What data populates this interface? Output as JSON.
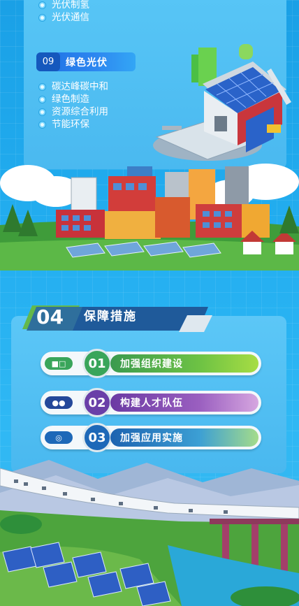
{
  "top_list": [
    "光伏制氢",
    "光伏通信"
  ],
  "section09": {
    "num": "09",
    "title": "绿色光伏",
    "items": [
      "碳达峰碳中和",
      "绿色制造",
      "资源综合利用",
      "节能环保"
    ]
  },
  "section04": {
    "num": "04",
    "title": "保障措施"
  },
  "measures": [
    {
      "num": "01",
      "label": "加强组织建设",
      "icon": "org-chart-icon",
      "color": "#39a55a"
    },
    {
      "num": "02",
      "label": "构建人才队伍",
      "icon": "people-icon",
      "color": "#6a3fa8"
    },
    {
      "num": "03",
      "label": "加强应用实施",
      "icon": "satellite-icon",
      "color": "#1d68b8"
    }
  ]
}
